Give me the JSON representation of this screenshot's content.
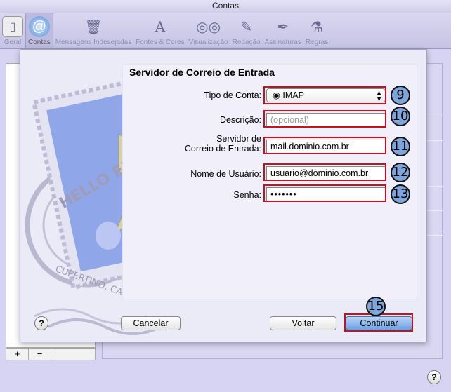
{
  "window": {
    "title": "Contas"
  },
  "toolbar": {
    "items": [
      {
        "label": "Geral",
        "icon": "switch-icon"
      },
      {
        "label": "Contas",
        "icon": "at-icon"
      },
      {
        "label": "Mensagens Indesejadas",
        "icon": "junk-icon"
      },
      {
        "label": "Fontes & Cores",
        "icon": "fonts-icon"
      },
      {
        "label": "Visualização",
        "icon": "glasses-icon"
      },
      {
        "label": "Redação",
        "icon": "pencil-icon"
      },
      {
        "label": "Assinaturas",
        "icon": "pen-icon"
      },
      {
        "label": "Regras",
        "icon": "rules-icon"
      }
    ]
  },
  "list": {
    "add": "+",
    "remove": "−"
  },
  "sheet": {
    "title": "Servidor de Correio de Entrada",
    "account_type_label": "Tipo de Conta:",
    "account_type_value": "IMAP",
    "description_label": "Descrição:",
    "description_placeholder": "(opcional)",
    "server_label_1": "Servidor de",
    "server_label_2": "Correio de Entrada:",
    "server_value": "mail.dominio.com.br",
    "user_label": "Nome de Usuário:",
    "user_value": "usuario@dominio.com.br",
    "password_label": "Senha:",
    "password_value": "•••••••",
    "stamp_text_1": "HELLO FR",
    "stamp_text_2": "CUPERTINO, CA",
    "help": "?",
    "cancel": "Cancelar",
    "back": "Voltar",
    "continue": "Continuar"
  },
  "callouts": [
    "9",
    "10",
    "11",
    "12",
    "13",
    "15"
  ],
  "window_help": "?",
  "colors": {
    "highlight": "#c8101f",
    "callout": "#7ea6dd"
  }
}
